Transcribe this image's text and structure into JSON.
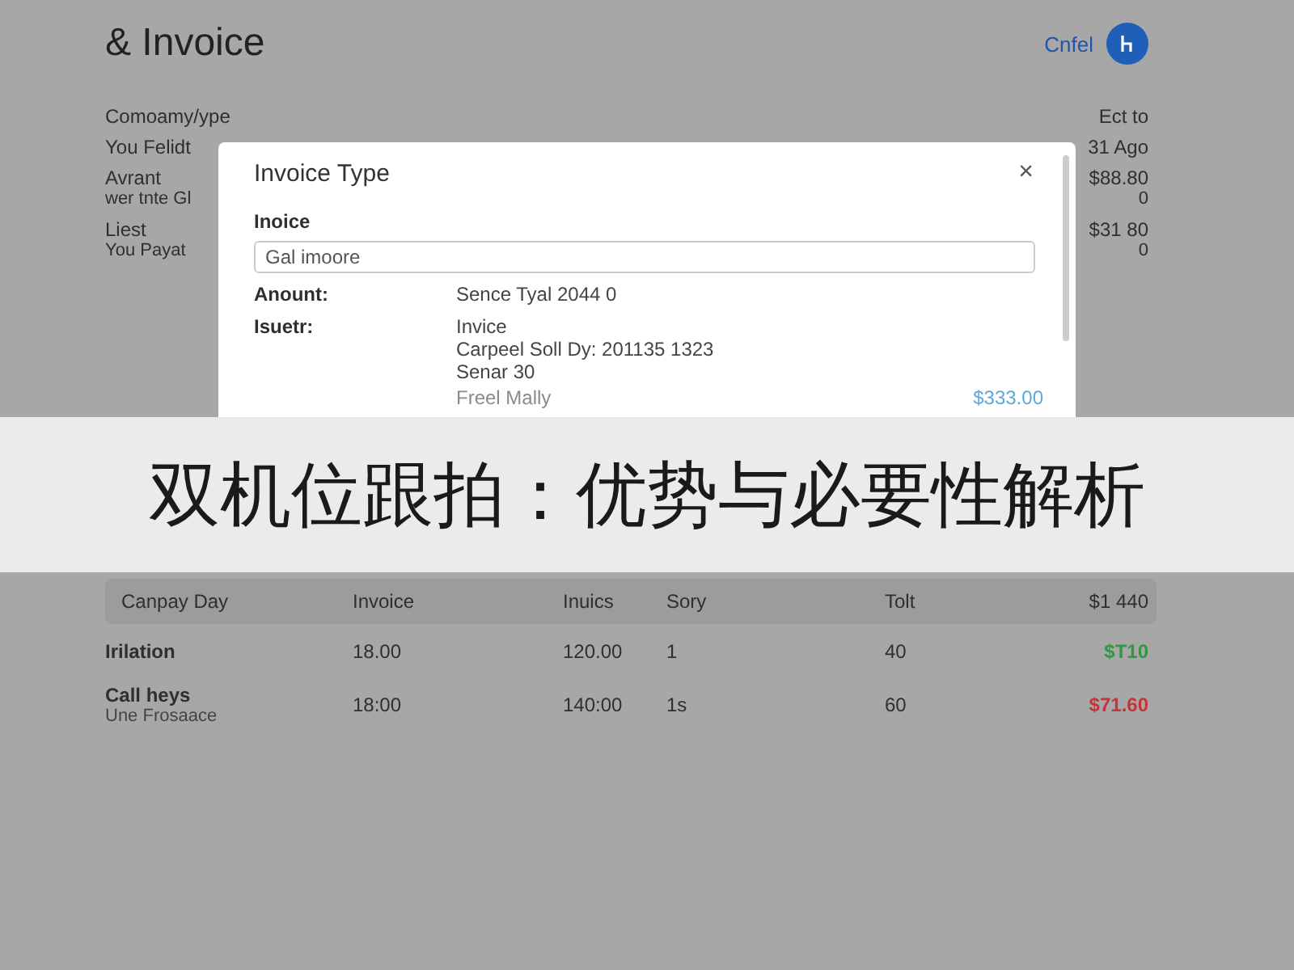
{
  "header": {
    "title": "& Invoice",
    "link": "Cnfel"
  },
  "details": [
    {
      "label": "Comoamy/ype",
      "value": "Ect to"
    },
    {
      "label": "You Felidt",
      "value": "31 Ago"
    },
    {
      "label": "Avrant",
      "sublabel": "wer tnte Gl",
      "value": "$88.80",
      "subvalue": "0"
    },
    {
      "label": "Liest",
      "sublabel": "You Payat",
      "value": "$31 80",
      "subvalue": "0"
    }
  ],
  "dialog": {
    "title": "Invoice Type",
    "close": "×",
    "field_label": "Inoice",
    "field_value": "Gal imoore",
    "rows": [
      {
        "label": "Anount:",
        "lines": [
          "Sence Tyal 2044 0"
        ]
      },
      {
        "label": "Isuetr:",
        "lines": [
          "Invice",
          "Carpeel Soll Dy: 201135 1323",
          "Senar 30"
        ]
      }
    ],
    "faded_label": "Freel Mally",
    "faded_amount": "$333.00"
  },
  "table": {
    "columns": [
      "Canpay Day",
      "Invoice",
      "Inuics",
      "Sory",
      "Tolt",
      "$1 440"
    ],
    "rows": [
      {
        "cells": [
          "Irilation",
          "18.00",
          "120.00",
          "1",
          "40"
        ],
        "amount": "$T10",
        "color": "#2e9a3e"
      },
      {
        "cells": [
          "Call heys",
          "18:00",
          "140:00",
          "1s",
          "60"
        ],
        "note": "Une Frosaace",
        "amount": "$71.60",
        "color": "#c8323a"
      }
    ]
  },
  "title_banner": "双机位跟拍：优势与必要性解析"
}
